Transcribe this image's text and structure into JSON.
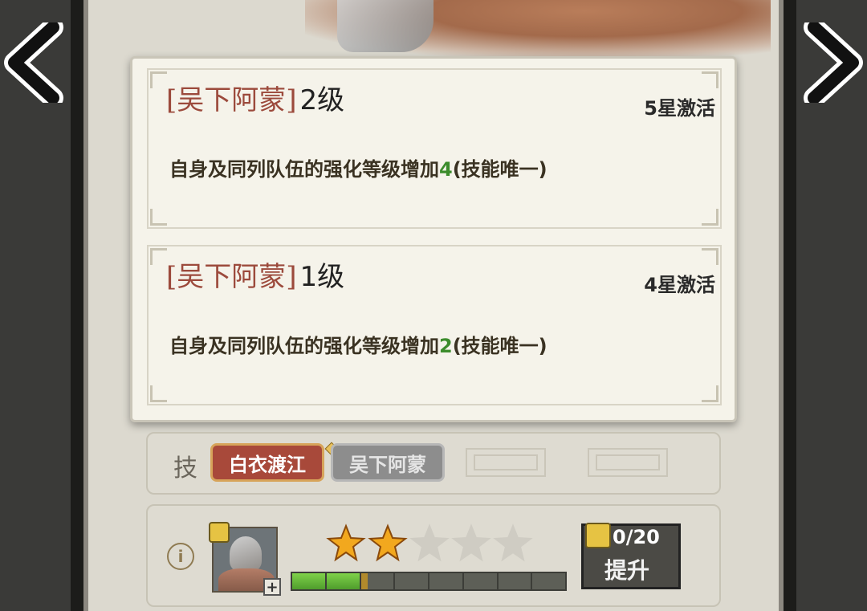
{
  "entries": [
    {
      "skill_name": "[吴下阿蒙]",
      "level": "2级",
      "activate": "5星激活",
      "desc_prefix": "自身及同列队伍的强化等级增加",
      "desc_num": "4",
      "desc_suffix": "(技能唯一)"
    },
    {
      "skill_name": "[吴下阿蒙]",
      "level": "1级",
      "activate": "4星激活",
      "desc_prefix": "自身及同列队伍的强化等级增加",
      "desc_num": "2",
      "desc_suffix": "(技能唯一)"
    }
  ],
  "skill_bar": {
    "label": "技",
    "skills": [
      "白衣渡江",
      "吴下阿蒙"
    ]
  },
  "hero": {
    "info_symbol": "i",
    "plus_symbol": "+",
    "stars_filled": 2,
    "stars_total": 5,
    "progress_segments_total": 8,
    "progress_segments_filled": 2,
    "upgrade_count": "0/20",
    "upgrade_label": "提升"
  },
  "colors": {
    "skill_name": "#9c4a3c",
    "highlight_number": "#3c8c2c",
    "active_skill_bg": "#a8493a",
    "star": "#f2a81e"
  }
}
